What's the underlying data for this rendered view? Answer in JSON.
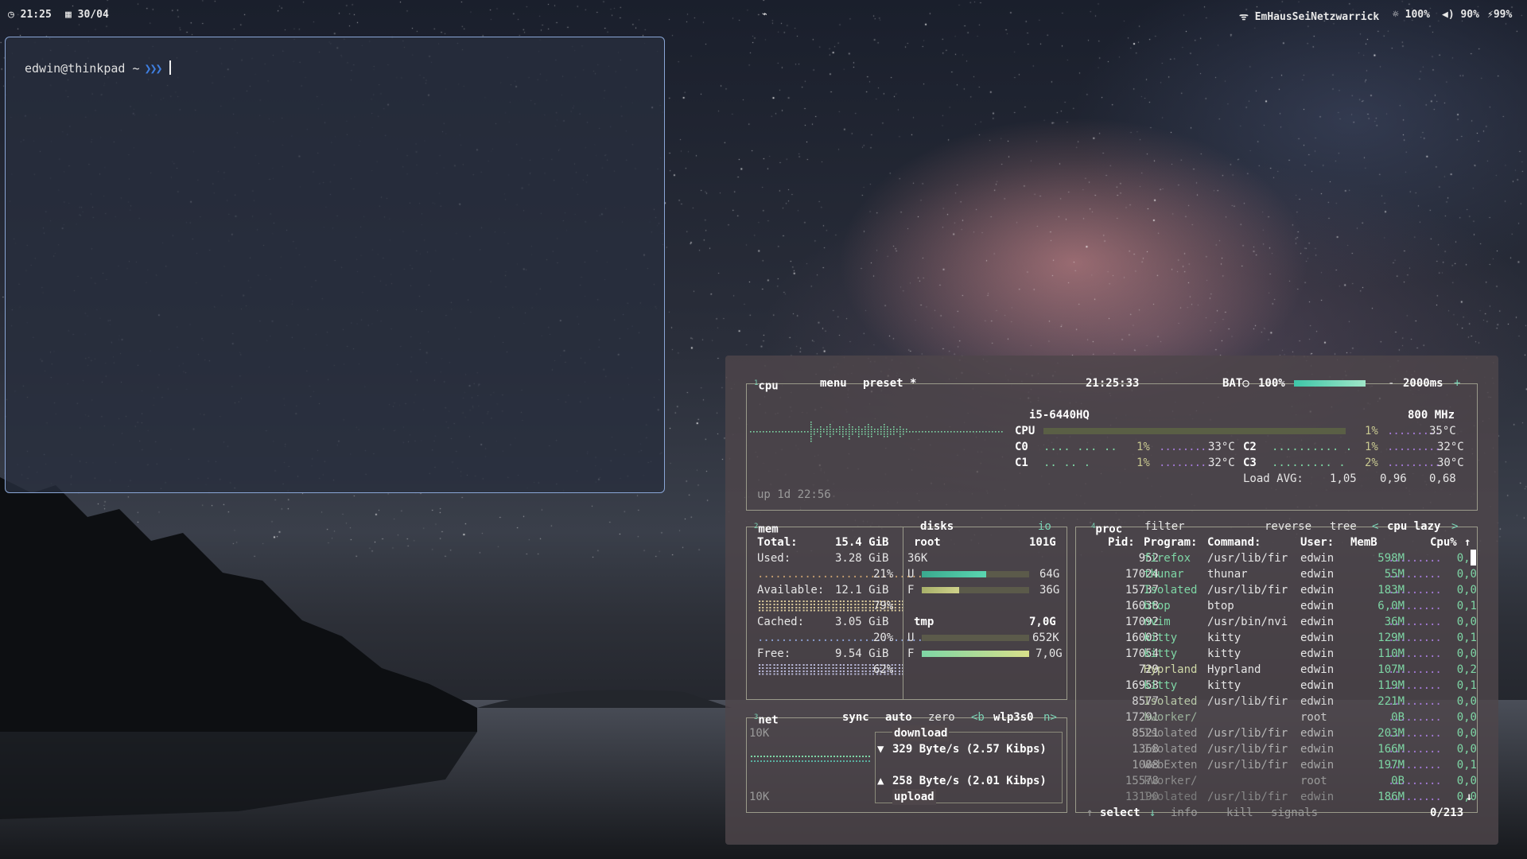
{
  "topbar": {
    "time": "21:25",
    "date": "30/04",
    "network": "EmHausSeiNetzwarrick",
    "brightness": "100%",
    "volume": "90%",
    "battery": "99%"
  },
  "terminal": {
    "prompt": "edwin@thinkpad ~",
    "arrows": "❯❯❯"
  },
  "btop": {
    "cpu_box": {
      "tab_num": "1",
      "title": "cpu",
      "menu": "menu",
      "preset": "preset *",
      "clock": "21:25:33",
      "battery_label": "BAT○",
      "battery_pct": "100%",
      "battery_level": 1.0,
      "interval_minus": "-",
      "interval": "2000ms",
      "interval_plus": "+",
      "cpu_model": "i5-6440HQ",
      "freq": "800 MHz",
      "uptime": "up 1d 22:56",
      "total": {
        "label": "CPU",
        "pct": "1%",
        "temp": "35°C"
      },
      "cores": [
        {
          "label": "C0",
          "pct": "1%",
          "temp": "33°C"
        },
        {
          "label": "C1",
          "pct": "1%",
          "temp": "32°C"
        },
        {
          "label": "C2",
          "pct": "1%",
          "temp": "32°C"
        },
        {
          "label": "C3",
          "pct": "2%",
          "temp": "30°C"
        }
      ],
      "load_label": "Load AVG:",
      "load": [
        "1,05",
        "0,96",
        "0,68"
      ]
    },
    "mem_box": {
      "tab_num": "2",
      "title": "mem",
      "rows": [
        {
          "label": "Total:",
          "value": "15.4 GiB",
          "pct": ""
        },
        {
          "label": "Used:",
          "value": "3.28 GiB",
          "pct": "21%"
        },
        {
          "label": "Available:",
          "value": "12.1 GiB",
          "pct": "79%"
        },
        {
          "label": "Cached:",
          "value": "3.05 GiB",
          "pct": "20%"
        },
        {
          "label": "Free:",
          "value": "9.54 GiB",
          "pct": "62%"
        }
      ]
    },
    "disks_box": {
      "title": "disks",
      "io": "io",
      "root": {
        "name": "root",
        "size": "101G",
        "io": "36K",
        "used_label": "U",
        "used": "64G",
        "used_frac": 0.6,
        "free_label": "F",
        "free": "36G",
        "free_frac": 0.35
      },
      "tmp": {
        "name": "tmp",
        "size": "7,0G",
        "used_label": "U",
        "used": "652K",
        "used_frac": 0.0,
        "free_label": "F",
        "free": "7,0G",
        "free_frac": 1.0
      }
    },
    "net_box": {
      "tab_num": "3",
      "title": "net",
      "sync": "sync",
      "auto": "auto",
      "zero": "zero",
      "prev": "<b",
      "iface": "wlp3s0",
      "next": "n>",
      "scale_top": "10K",
      "scale_bottom": "10K",
      "download_label": "download",
      "download_arrow": "▼",
      "download": "329 Byte/s (2.57 Kibps)",
      "upload_arrow": "▲",
      "upload": "258 Byte/s (2.01 Kibps)",
      "upload_label": "upload"
    },
    "proc_box": {
      "tab_num": "4",
      "title": "proc",
      "filter": "filter",
      "reverse": "reverse",
      "tree": "tree",
      "sort_prev": "<",
      "sort": "cpu lazy",
      "sort_next": ">",
      "headers": {
        "pid": "Pid:",
        "program": "Program:",
        "command": "Command:",
        "user": "User:",
        "mem": "MemB",
        "cpu": "Cpu%"
      },
      "sort_arrow": "↑",
      "rows": [
        {
          "pid": "952",
          "program": "firefox",
          "command": "/usr/lib/fir",
          "user": "edwin",
          "mem": "598M",
          "cpu": "0,1"
        },
        {
          "pid": "17024",
          "program": "thunar",
          "command": "thunar",
          "user": "edwin",
          "mem": "55M",
          "cpu": "0,0"
        },
        {
          "pid": "15737",
          "program": "Isolated",
          "command": "/usr/lib/fir",
          "user": "edwin",
          "mem": "183M",
          "cpu": "0,0"
        },
        {
          "pid": "16038",
          "program": "btop",
          "command": "btop",
          "user": "edwin",
          "mem": "6,0M",
          "cpu": "0,1"
        },
        {
          "pid": "17092",
          "program": "nvim",
          "command": "/usr/bin/nvi",
          "user": "edwin",
          "mem": "36M",
          "cpu": "0,0"
        },
        {
          "pid": "16003",
          "program": "kitty",
          "command": "kitty",
          "user": "edwin",
          "mem": "129M",
          "cpu": "0,1"
        },
        {
          "pid": "17054",
          "program": "kitty",
          "command": "kitty",
          "user": "edwin",
          "mem": "110M",
          "cpu": "0,0"
        },
        {
          "pid": "729",
          "program": "Hyprland",
          "command": "Hyprland",
          "user": "edwin",
          "mem": "107M",
          "cpu": "0,2"
        },
        {
          "pid": "16958",
          "program": "kitty",
          "command": "kitty",
          "user": "edwin",
          "mem": "119M",
          "cpu": "0,1"
        },
        {
          "pid": "8577",
          "program": "Isolated",
          "command": "/usr/lib/fir",
          "user": "edwin",
          "mem": "221M",
          "cpu": "0,0"
        },
        {
          "pid": "17291",
          "program": "kworker/",
          "command": "",
          "user": "root",
          "mem": "0B",
          "cpu": "0,0"
        },
        {
          "pid": "8521",
          "program": "Isolated",
          "command": "/usr/lib/fir",
          "user": "edwin",
          "mem": "203M",
          "cpu": "0,0"
        },
        {
          "pid": "1368",
          "program": "Isolated",
          "command": "/usr/lib/fir",
          "user": "edwin",
          "mem": "166M",
          "cpu": "0,0"
        },
        {
          "pid": "1088",
          "program": "WebExten",
          "command": "/usr/lib/fir",
          "user": "edwin",
          "mem": "197M",
          "cpu": "0,1"
        },
        {
          "pid": "15578",
          "program": "kworker/",
          "command": "",
          "user": "root",
          "mem": "0B",
          "cpu": "0,0"
        },
        {
          "pid": "13190",
          "program": "Isolated",
          "command": "/usr/lib/fir",
          "user": "edwin",
          "mem": "186M",
          "cpu": "0,0"
        }
      ],
      "scroll_down": "↓",
      "footer": {
        "up": "↑",
        "select": "select",
        "down": "↓",
        "info": "info",
        "kill": "kill",
        "signals": "signals",
        "count": "0/213"
      }
    }
  },
  "colors": {
    "accent": "#7ad3b5",
    "border": "#9a9a8a",
    "terminal_border": "#8aa6d6",
    "arrows": "#3f7fe0"
  }
}
